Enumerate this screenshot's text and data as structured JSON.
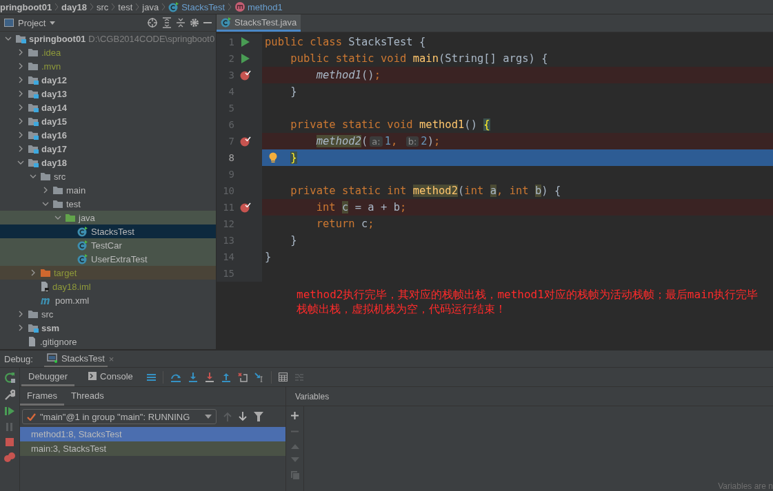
{
  "breadcrumb": [
    {
      "label": "pringboot01",
      "kind": "module"
    },
    {
      "label": "day18",
      "kind": "module"
    },
    {
      "label": "src",
      "kind": "folder"
    },
    {
      "label": "test",
      "kind": "folder"
    },
    {
      "label": "java",
      "kind": "folder"
    },
    {
      "label": "StacksTest",
      "kind": "class"
    },
    {
      "label": "method1",
      "kind": "method"
    }
  ],
  "project": {
    "title": "Project",
    "tree": [
      {
        "label": "springboot01",
        "kind": "module",
        "expanded": true,
        "ignored": false,
        "selected": false,
        "hint": "D:\\CGB2014CODE\\springboot0",
        "children": [
          {
            "label": ".idea",
            "kind": "folder",
            "expanded": false,
            "ignored": true,
            "selected": false
          },
          {
            "label": ".mvn",
            "kind": "folder",
            "expanded": false,
            "ignored": true,
            "selected": false
          },
          {
            "label": "day12",
            "kind": "module",
            "expanded": false,
            "ignored": false,
            "selected": false
          },
          {
            "label": "day13",
            "kind": "module",
            "expanded": false,
            "ignored": false,
            "selected": false
          },
          {
            "label": "day14",
            "kind": "module",
            "expanded": false,
            "ignored": false,
            "selected": false
          },
          {
            "label": "day15",
            "kind": "module",
            "expanded": false,
            "ignored": false,
            "selected": false
          },
          {
            "label": "day16",
            "kind": "module",
            "expanded": false,
            "ignored": false,
            "selected": false
          },
          {
            "label": "day17",
            "kind": "module",
            "expanded": false,
            "ignored": false,
            "selected": false
          },
          {
            "label": "day18",
            "kind": "module",
            "expanded": true,
            "ignored": false,
            "selected": false,
            "children": [
              {
                "label": "src",
                "kind": "folder",
                "expanded": true,
                "ignored": false,
                "selected": false,
                "children": [
                  {
                    "label": "main",
                    "kind": "folder",
                    "expanded": false,
                    "ignored": false,
                    "selected": false
                  },
                  {
                    "label": "test",
                    "kind": "folder",
                    "expanded": true,
                    "ignored": false,
                    "selected": false,
                    "children": [
                      {
                        "label": "java",
                        "kind": "test-root",
                        "expanded": true,
                        "ignored": false,
                        "selected": false,
                        "children": [
                          {
                            "label": "StacksTest",
                            "kind": "test-class",
                            "ignored": false,
                            "selected": true
                          },
                          {
                            "label": "TestCar",
                            "kind": "test-class",
                            "ignored": false,
                            "selected": false
                          },
                          {
                            "label": "UserExtraTest",
                            "kind": "test-class",
                            "ignored": false,
                            "selected": false
                          }
                        ]
                      }
                    ]
                  }
                ]
              },
              {
                "label": "target",
                "kind": "excluded",
                "expanded": false,
                "ignored": true,
                "selected": false
              },
              {
                "label": "day18.iml",
                "kind": "iml",
                "ignored": true,
                "selected": false
              },
              {
                "label": "pom.xml",
                "kind": "maven",
                "ignored": false,
                "selected": false
              }
            ]
          },
          {
            "label": "src",
            "kind": "folder",
            "expanded": false,
            "ignored": false,
            "selected": false
          },
          {
            "label": "ssm",
            "kind": "module",
            "expanded": false,
            "ignored": false,
            "selected": false
          },
          {
            "label": ".gitignore",
            "kind": "file",
            "ignored": false,
            "selected": false
          }
        ]
      }
    ]
  },
  "editor": {
    "tabs": [
      {
        "label": "StacksTest.java",
        "selected": true
      }
    ],
    "lines": [
      {
        "number": "1",
        "run": true,
        "breakpoint": false,
        "current": false,
        "bulb": false,
        "tokens": [
          {
            "text": "public class ",
            "kind": "keyword"
          },
          {
            "text": "StacksTest {",
            "kind": "plain"
          }
        ]
      },
      {
        "number": "2",
        "run": true,
        "breakpoint": false,
        "current": false,
        "bulb": false,
        "tokens": [
          {
            "text": "    public static void ",
            "kind": "keyword"
          },
          {
            "text": "main",
            "kind": "declaration"
          },
          {
            "text": "(String[] args) {",
            "kind": "plain"
          }
        ]
      },
      {
        "number": "3",
        "run": false,
        "breakpoint": true,
        "current": false,
        "bulb": false,
        "tokens": [
          {
            "text": "        method1",
            "kind": "call"
          },
          {
            "text": "()",
            "kind": "plain"
          },
          {
            "text": ";",
            "kind": "keyword"
          }
        ]
      },
      {
        "number": "4",
        "run": false,
        "breakpoint": false,
        "current": false,
        "bulb": false,
        "tokens": [
          {
            "text": "    }",
            "kind": "plain"
          }
        ]
      },
      {
        "number": "5",
        "run": false,
        "breakpoint": false,
        "current": false,
        "bulb": false
      },
      {
        "number": "6",
        "run": false,
        "breakpoint": false,
        "current": false,
        "bulb": false,
        "tokens": [
          {
            "text": "    private static void ",
            "kind": "keyword"
          },
          {
            "text": "method1",
            "kind": "declaration"
          },
          {
            "text": "() ",
            "kind": "plain"
          },
          {
            "text": "{",
            "kind": "brace"
          }
        ]
      },
      {
        "number": "7",
        "run": false,
        "breakpoint": true,
        "current": false,
        "bulb": false,
        "tokens": [
          {
            "text": "        method2",
            "kind": "call-usage"
          },
          {
            "text": "(",
            "kind": "plain"
          },
          {
            "text": "a:",
            "kind": "hint"
          },
          {
            "text": "1",
            "kind": "number"
          },
          {
            "text": ", ",
            "kind": "keyword"
          },
          {
            "text": "b:",
            "kind": "hint"
          },
          {
            "text": "2",
            "kind": "number"
          },
          {
            "text": ")",
            "kind": "plain"
          },
          {
            "text": ";",
            "kind": "keyword"
          }
        ]
      },
      {
        "number": "8",
        "run": false,
        "breakpoint": false,
        "current": true,
        "bulb": true,
        "tokens": [
          {
            "text": "    }",
            "kind": "brace"
          }
        ]
      },
      {
        "number": "9",
        "run": false,
        "breakpoint": false,
        "current": false,
        "bulb": false
      },
      {
        "number": "10",
        "run": false,
        "breakpoint": false,
        "current": false,
        "bulb": false,
        "tokens": [
          {
            "text": "    private static int ",
            "kind": "keyword"
          },
          {
            "text": "method2",
            "kind": "declaration-usage"
          },
          {
            "text": "(",
            "kind": "plain"
          },
          {
            "text": "int ",
            "kind": "keyword"
          },
          {
            "text": "a",
            "kind": "usage"
          },
          {
            "text": ", ",
            "kind": "keyword"
          },
          {
            "text": "int ",
            "kind": "keyword"
          },
          {
            "text": "b",
            "kind": "usage"
          },
          {
            "text": ") {",
            "kind": "plain"
          }
        ]
      },
      {
        "number": "11",
        "run": false,
        "breakpoint": true,
        "current": false,
        "bulb": false,
        "tokens": [
          {
            "text": "        int ",
            "kind": "keyword"
          },
          {
            "text": "c",
            "kind": "usage"
          },
          {
            "text": " = a + b",
            "kind": "plain"
          },
          {
            "text": ";",
            "kind": "keyword"
          }
        ]
      },
      {
        "number": "12",
        "run": false,
        "breakpoint": false,
        "current": false,
        "bulb": false,
        "tokens": [
          {
            "text": "        return ",
            "kind": "keyword"
          },
          {
            "text": "c",
            "kind": "plain"
          },
          {
            "text": ";",
            "kind": "keyword"
          }
        ]
      },
      {
        "number": "13",
        "run": false,
        "breakpoint": false,
        "current": false,
        "bulb": false,
        "tokens": [
          {
            "text": "    }",
            "kind": "plain"
          }
        ]
      },
      {
        "number": "14",
        "run": false,
        "breakpoint": false,
        "current": false,
        "bulb": false,
        "tokens": [
          {
            "text": "}",
            "kind": "plain"
          }
        ]
      },
      {
        "number": "15",
        "run": false,
        "breakpoint": false,
        "current": false,
        "bulb": false
      }
    ],
    "annotation": [
      "method2执行完毕，其对应的栈帧出栈，method1对应的栈帧为活动栈帧；最后main执行完毕",
      "栈帧出栈，虚拟机栈为空，代码运行结束！"
    ]
  },
  "debug": {
    "label": "Debug:",
    "session_tab": "StacksTest",
    "session_close": "×",
    "tabs": [
      {
        "label": "Debugger",
        "kind": "debugger",
        "selected": true
      },
      {
        "label": "Console",
        "kind": "console",
        "selected": false
      }
    ],
    "frame_tabs": [
      {
        "label": "Frames",
        "selected": true
      },
      {
        "label": "Threads",
        "selected": false
      }
    ],
    "thread": "\"main\"@1 in group \"main\": RUNNING",
    "frames": [
      {
        "label": "method1:8, StacksTest",
        "selected": true
      },
      {
        "label": "main:3, StacksTest",
        "selected": false
      }
    ],
    "variables_title": "Variables",
    "variables_note": "Variables are n"
  }
}
